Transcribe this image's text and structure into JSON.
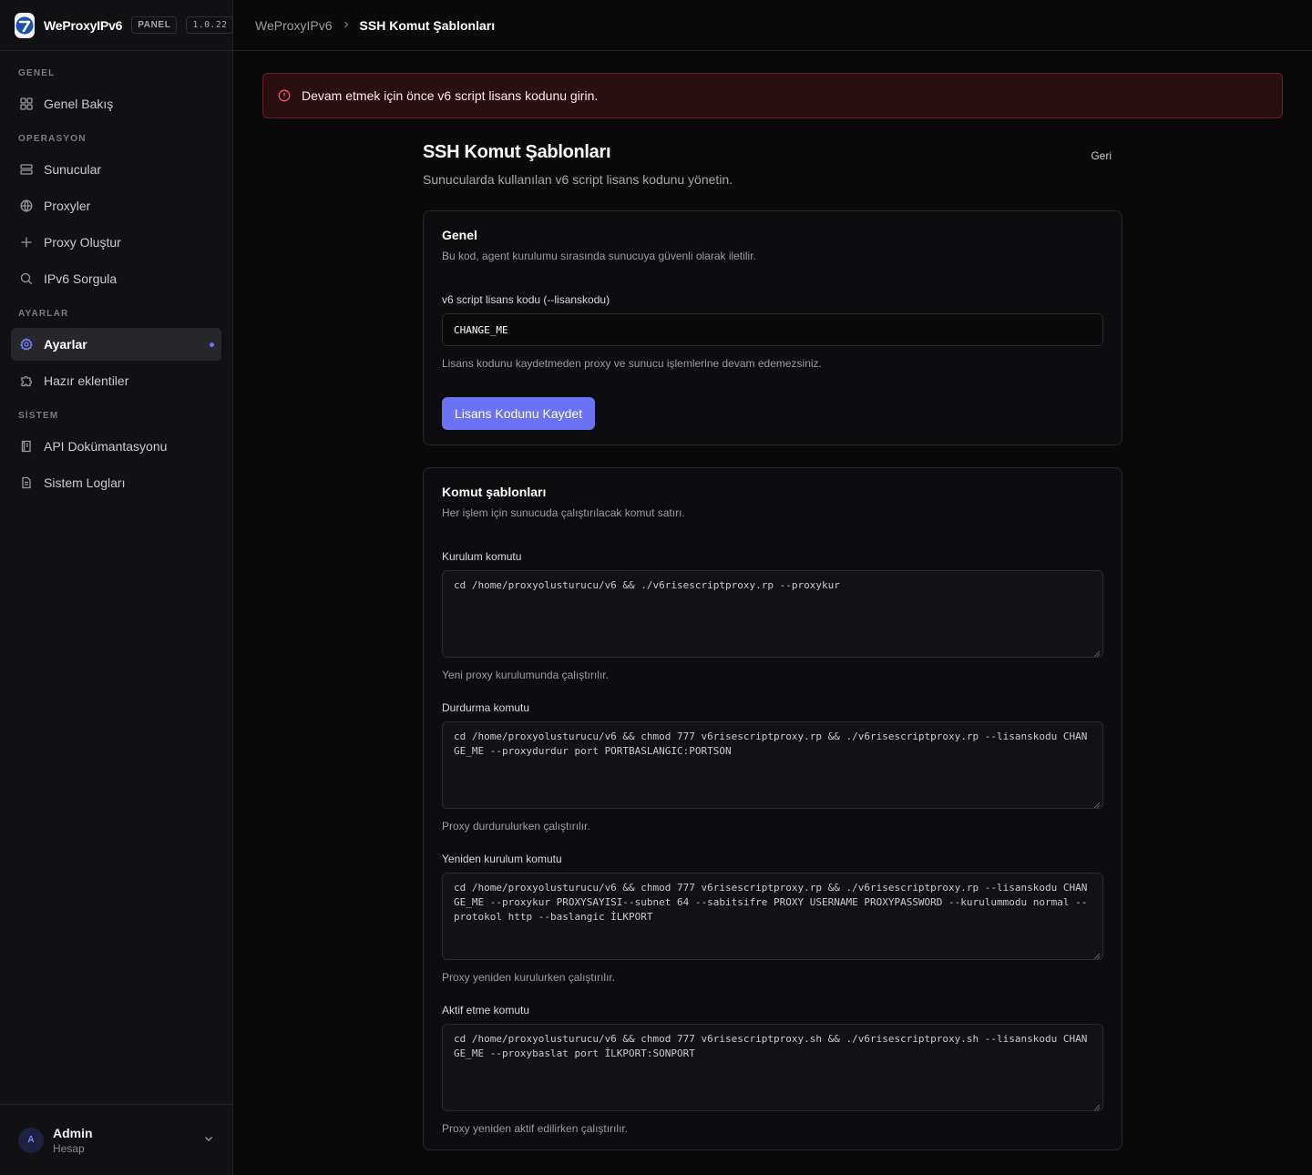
{
  "brand": {
    "name": "WeProxyIPv6",
    "panel_badge": "PANEL",
    "version": "1.0.22"
  },
  "sidebar": {
    "sections": [
      {
        "title": "GENEL",
        "items": [
          {
            "label": "Genel Bakış",
            "icon": "grid-icon"
          }
        ]
      },
      {
        "title": "OPERASYON",
        "items": [
          {
            "label": "Sunucular",
            "icon": "server-icon"
          },
          {
            "label": "Proxyler",
            "icon": "globe-icon"
          },
          {
            "label": "Proxy Oluştur",
            "icon": "plus-icon"
          },
          {
            "label": "IPv6 Sorgula",
            "icon": "search-icon"
          }
        ]
      },
      {
        "title": "AYARLAR",
        "items": [
          {
            "label": "Ayarlar",
            "icon": "gear-icon",
            "active": true
          },
          {
            "label": "Hazır eklentiler",
            "icon": "puzzle-icon"
          }
        ]
      },
      {
        "title": "SİSTEM",
        "items": [
          {
            "label": "API Dokümantasyonu",
            "icon": "book-icon"
          },
          {
            "label": "Sistem Logları",
            "icon": "file-icon"
          }
        ]
      }
    ],
    "user": {
      "initial": "A",
      "name": "Admin",
      "role": "Hesap"
    }
  },
  "breadcrumb": {
    "root": "WeProxyIPv6",
    "current": "SSH Komut Şablonları"
  },
  "alert": {
    "text": "Devam etmek için önce v6 script lisans kodunu girin."
  },
  "page": {
    "title": "SSH Komut Şablonları",
    "back_label": "Geri",
    "subtitle": "Sunucularda kullanılan v6 script lisans kodunu yönetin."
  },
  "general_card": {
    "title": "Genel",
    "description": "Bu kod, agent kurulumu sırasında sunucuya güvenli olarak iletilir.",
    "field_label": "v6 script lisans kodu (--lisanskodu)",
    "field_value": "CHANGE_ME",
    "hint": "Lisans kodunu kaydetmeden proxy ve sunucu işlemlerine devam edemezsiniz.",
    "button_label": "Lisans Kodunu Kaydet"
  },
  "commands_card": {
    "title": "Komut şablonları",
    "description": "Her işlem için sunucuda çalıştırılacak komut satırı.",
    "fields": [
      {
        "label": "Kurulum komutu",
        "value": "cd /home/proxyolusturucu/v6 && ./v6risescriptproxy.rp --proxykur",
        "hint": "Yeni proxy kurulumunda çalıştırılır."
      },
      {
        "label": "Durdurma komutu",
        "value": "cd /home/proxyolusturucu/v6 && chmod 777 v6risescriptproxy.rp && ./v6risescriptproxy.rp --lisanskodu CHANGE_ME --proxydurdur port PORTBASLANGIC:PORTSON",
        "hint": "Proxy durdurulurken çalıştırılır."
      },
      {
        "label": "Yeniden kurulum komutu",
        "value": "cd /home/proxyolusturucu/v6 && chmod 777 v6risescriptproxy.rp && ./v6risescriptproxy.rp --lisanskodu CHANGE_ME --proxykur PROXYSAYISI--subnet 64 --sabitsifre PROXY USERNAME PROXYPASSWORD --kurulummodu normal --protokol http --baslangic İLKPORT",
        "hint": "Proxy yeniden kurulurken çalıştırılır."
      },
      {
        "label": "Aktif etme komutu",
        "value": "cd /home/proxyolusturucu/v6 && chmod 777 v6risescriptproxy.sh && ./v6risescriptproxy.sh --lisanskodu CHANGE_ME --proxybaslat port İLKPORT:SONPORT",
        "hint": "Proxy yeniden aktif edilirken çalıştırılır."
      }
    ]
  },
  "colors": {
    "accent": "#6b72f5",
    "alert_bg": "#2a0f12",
    "alert_border": "#6b1f24",
    "alert_icon": "#f15a5a"
  }
}
